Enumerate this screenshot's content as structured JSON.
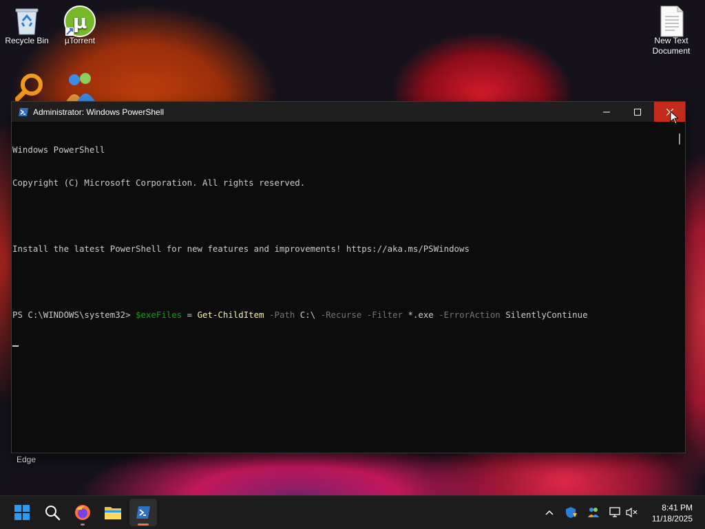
{
  "desktop": {
    "icons": [
      {
        "label": "Recycle Bin"
      },
      {
        "label": "µTorrent"
      },
      {
        "label": "New Text Document"
      },
      {
        "label": "Edge"
      }
    ]
  },
  "window": {
    "title": "Administrator: Windows PowerShell",
    "buttons": {
      "minimize": "minimize",
      "maximize": "maximize",
      "close": "close"
    }
  },
  "console": {
    "line1": "Windows PowerShell",
    "line2": "Copyright (C) Microsoft Corporation. All rights reserved.",
    "line3": "Install the latest PowerShell for new features and improvements! https://aka.ms/PSWindows",
    "prompt": "PS C:\\WINDOWS\\system32> ",
    "command": {
      "var": "$exeFiles",
      "eq": " = ",
      "cmdlet": "Get-ChildItem",
      "p1": " -Path",
      "v1": " C:\\",
      "p2": " -Recurse",
      "p3": " -Filter",
      "v3": " *.exe",
      "p4": " -ErrorAction",
      "v4": " SilentlyContinue"
    }
  },
  "taskbar": {
    "apps": [
      "start-icon",
      "search-icon",
      "firefox-icon",
      "file-explorer-icon",
      "powershell-icon"
    ],
    "tray": [
      "chevron-up-icon",
      "security-icon",
      "network-icon",
      "display-icon",
      "volume-muted-icon"
    ],
    "time": "8:41 PM",
    "date": "11/18/2025"
  },
  "colors": {
    "close_button": "#c42b1c",
    "ps_variable": "#13a10e",
    "ps_cmdlet": "#f9f1a5",
    "ps_parameter": "#767676"
  }
}
